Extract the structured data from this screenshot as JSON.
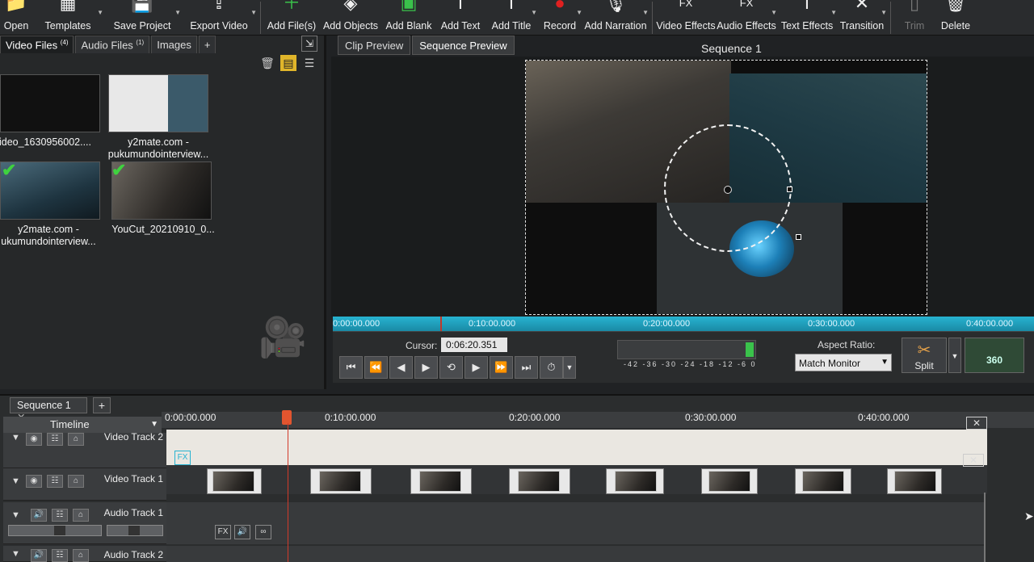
{
  "toolbar": {
    "items": [
      {
        "label": "Open",
        "icon": "folder-icon"
      },
      {
        "label": "Templates",
        "icon": "templates-icon"
      },
      {
        "label": "Save Project",
        "icon": "save-icon"
      },
      {
        "label": "Export Video",
        "icon": "export-icon"
      },
      {
        "label": "Add File(s)",
        "icon": "add-file-icon"
      },
      {
        "label": "Add Objects",
        "icon": "add-objects-icon"
      },
      {
        "label": "Add Blank",
        "icon": "add-blank-icon"
      },
      {
        "label": "Add Text",
        "icon": "add-text-icon"
      },
      {
        "label": "Add Title",
        "icon": "add-title-icon"
      },
      {
        "label": "Record",
        "icon": "record-icon"
      },
      {
        "label": "Add Narration",
        "icon": "microphone-icon"
      },
      {
        "label": "Video Effects",
        "icon": "video-fx-icon"
      },
      {
        "label": "Audio Effects",
        "icon": "audio-fx-icon"
      },
      {
        "label": "Text Effects",
        "icon": "text-fx-icon"
      },
      {
        "label": "Transition",
        "icon": "transition-icon"
      },
      {
        "label": "Trim",
        "icon": "trim-icon"
      },
      {
        "label": "Delete",
        "icon": "trash-icon"
      }
    ]
  },
  "media": {
    "tabs": [
      {
        "label": "Video Files",
        "count": "(4)"
      },
      {
        "label": "Audio Files",
        "count": "(1)"
      },
      {
        "label": "Images",
        "count": ""
      },
      {
        "label": "+",
        "count": ""
      }
    ],
    "items": [
      {
        "caption1": "ideo_1630956002....",
        "caption2": ""
      },
      {
        "caption1": "y2mate.com -",
        "caption2": "pukumundointerview..."
      },
      {
        "caption1": "y2mate.com -",
        "caption2": "ukumundointerview..."
      },
      {
        "caption1": "YouCut_20210910_0...",
        "caption2": ""
      }
    ]
  },
  "preview": {
    "tabs": [
      "Clip Preview",
      "Sequence Preview"
    ],
    "sequence_title": "Sequence 1",
    "ruler_labels": [
      "0:00:00.000",
      "0:10:00.000",
      "0:20:00.000",
      "0:30:00.000",
      "0:40:00.000"
    ],
    "cursor_label": "Cursor:",
    "cursor_value": "0:06:20.351",
    "meter_scale": "-42 -36 -30 -24 -18 -12 -6 0",
    "aspect_label": "Aspect Ratio:",
    "aspect_value": "Match Monitor",
    "split_label": "Split",
    "btn360_label": "360"
  },
  "timeline": {
    "sequence_tab": "Sequence 1",
    "add_tab": "+",
    "header": "Timeline",
    "ruler_labels": [
      "0:00:00.000",
      "0:10:00.000",
      "0:20:00.000",
      "0:30:00.000",
      "0:40:00.000"
    ],
    "tracks": [
      {
        "name": "Video Track 2"
      },
      {
        "name": "Video Track 1"
      },
      {
        "name": "Audio Track 1"
      },
      {
        "name": "Audio Track 2"
      }
    ]
  },
  "colors": {
    "accent": "#27b3d1",
    "playhead": "#d23a2a",
    "check": "#3fd23f"
  }
}
